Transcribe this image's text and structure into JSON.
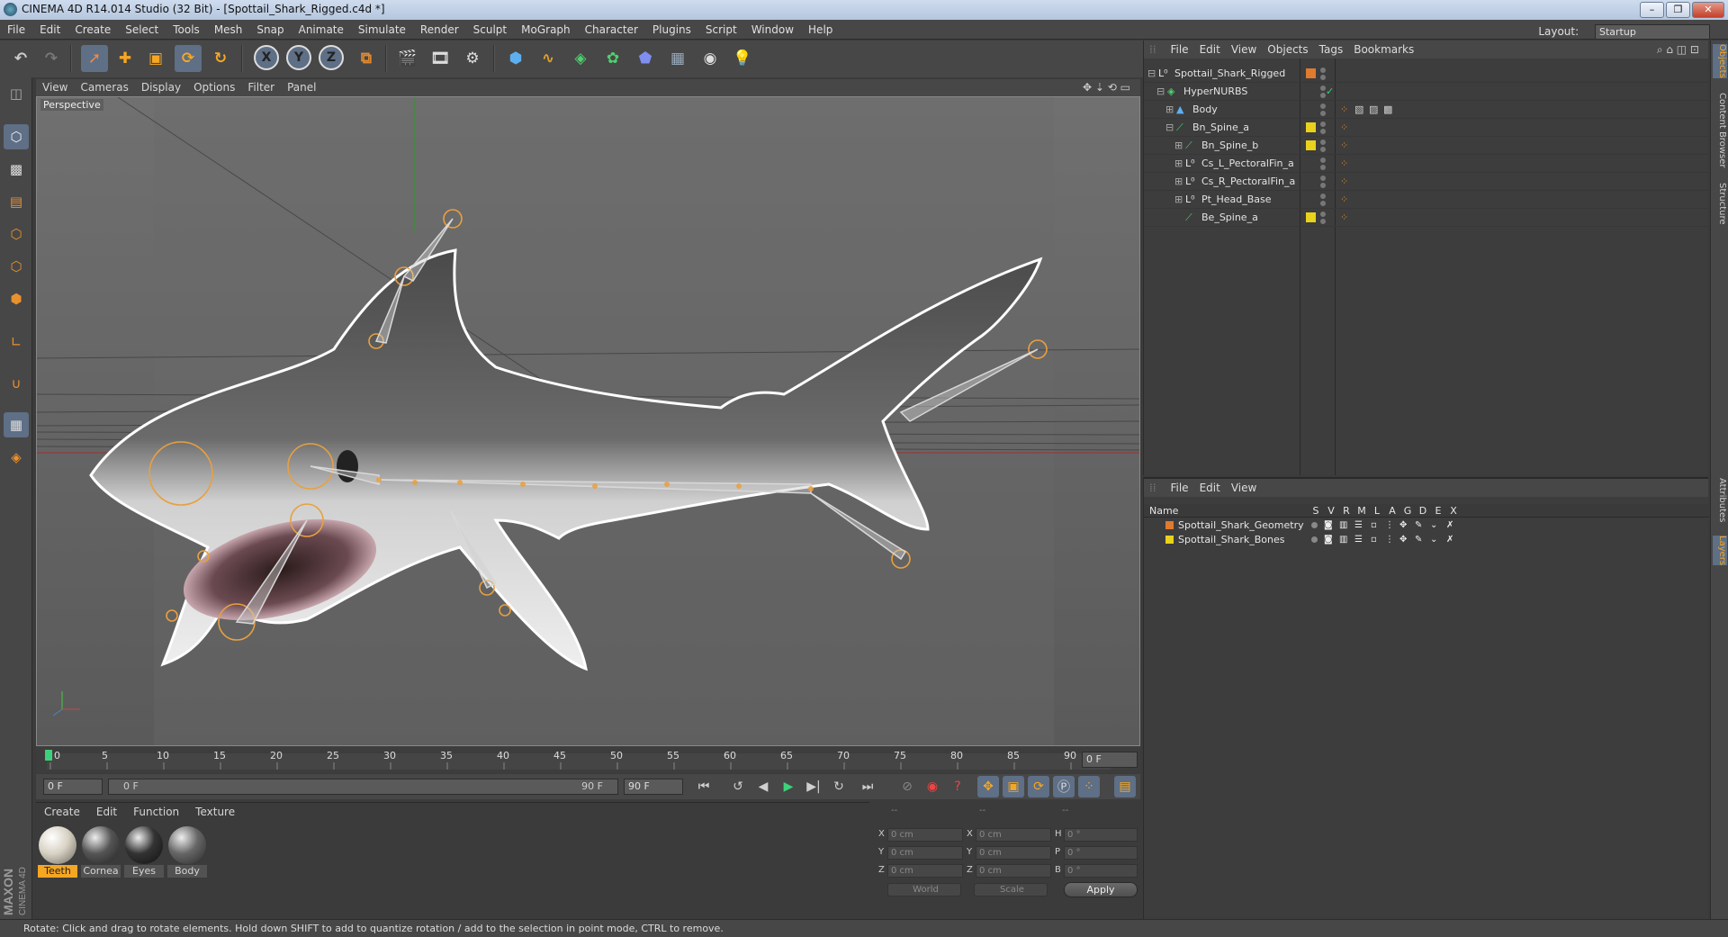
{
  "window": {
    "title": "CINEMA 4D R14.014 Studio (32 Bit) - [Spottail_Shark_Rigged.c4d *]",
    "minimize": "–",
    "maximize": "❐",
    "close": "✕"
  },
  "menubar": {
    "items": [
      "File",
      "Edit",
      "Create",
      "Select",
      "Tools",
      "Mesh",
      "Snap",
      "Animate",
      "Simulate",
      "Render",
      "Sculpt",
      "MoGraph",
      "Character",
      "Plugins",
      "Script",
      "Window",
      "Help"
    ],
    "layout_label": "Layout:",
    "layout_value": "Startup"
  },
  "toolbar": {
    "x_label": "X",
    "y_label": "Y",
    "z_label": "Z"
  },
  "viewport": {
    "menu": [
      "View",
      "Cameras",
      "Display",
      "Options",
      "Filter",
      "Panel"
    ],
    "camera_label": "Perspective"
  },
  "timeline": {
    "ticks": [
      "0",
      "5",
      "10",
      "15",
      "20",
      "25",
      "30",
      "35",
      "40",
      "45",
      "50",
      "55",
      "60",
      "65",
      "70",
      "75",
      "80",
      "85",
      "90"
    ],
    "current_frame": "0 F"
  },
  "transport": {
    "start_frame": "0 F",
    "range_start": "0 F",
    "range_end": "90 F",
    "end_frame": "90 F"
  },
  "materials": {
    "menu": [
      "Create",
      "Edit",
      "Function",
      "Texture"
    ],
    "items": [
      {
        "name": "Teeth",
        "selected": true
      },
      {
        "name": "Cornea",
        "selected": false
      },
      {
        "name": "Eyes",
        "selected": false
      },
      {
        "name": "Body",
        "selected": false
      }
    ]
  },
  "coords": {
    "col1_header": "--",
    "col2_header": "--",
    "col3_header": "--",
    "rows": [
      {
        "a": "X",
        "av": "0 cm",
        "b": "X",
        "bv": "0 cm",
        "c": "H",
        "cv": "0 °"
      },
      {
        "a": "Y",
        "av": "0 cm",
        "b": "Y",
        "bv": "0 cm",
        "c": "P",
        "cv": "0 °"
      },
      {
        "a": "Z",
        "av": "0 cm",
        "b": "Z",
        "bv": "0 cm",
        "c": "B",
        "cv": "0 °"
      }
    ],
    "mode1": "World",
    "mode2": "Scale",
    "apply": "Apply"
  },
  "object_manager": {
    "menu": [
      "File",
      "Edit",
      "View",
      "Objects",
      "Tags",
      "Bookmarks"
    ],
    "objects": [
      {
        "name": "Spottail_Shark_Rigged",
        "layer_color": "#e07a2e"
      },
      {
        "name": "HyperNURBS",
        "layer_color": ""
      },
      {
        "name": "Body",
        "layer_color": ""
      },
      {
        "name": "Bn_Spine_a",
        "layer_color": "#e8d21c"
      },
      {
        "name": "Bn_Spine_b",
        "layer_color": "#e8d21c"
      },
      {
        "name": "Cs_L_PectoralFin_a",
        "layer_color": ""
      },
      {
        "name": "Cs_R_PectoralFin_a",
        "layer_color": ""
      },
      {
        "name": "Pt_Head_Base",
        "layer_color": ""
      },
      {
        "name": "Be_Spine_a",
        "layer_color": "#e8d21c"
      }
    ]
  },
  "layer_manager": {
    "menu": [
      "File",
      "Edit",
      "View"
    ],
    "header_name": "Name",
    "header_flags": [
      "S",
      "V",
      "R",
      "M",
      "L",
      "A",
      "G",
      "D",
      "E",
      "X"
    ],
    "layers": [
      {
        "name": "Spottail_Shark_Geometry",
        "color": "#e07a2e"
      },
      {
        "name": "Spottail_Shark_Bones",
        "color": "#e8d21c"
      }
    ]
  },
  "right_tabs": [
    "Objects",
    "Content Browser",
    "Structure",
    "Attributes",
    "Layers"
  ],
  "branding": {
    "maxon": "MAXON",
    "product": "CINEMA 4D"
  },
  "status": "Rotate: Click and drag to rotate elements. Hold down SHIFT to add to quantize rotation / add to the selection in point mode, CTRL to remove."
}
